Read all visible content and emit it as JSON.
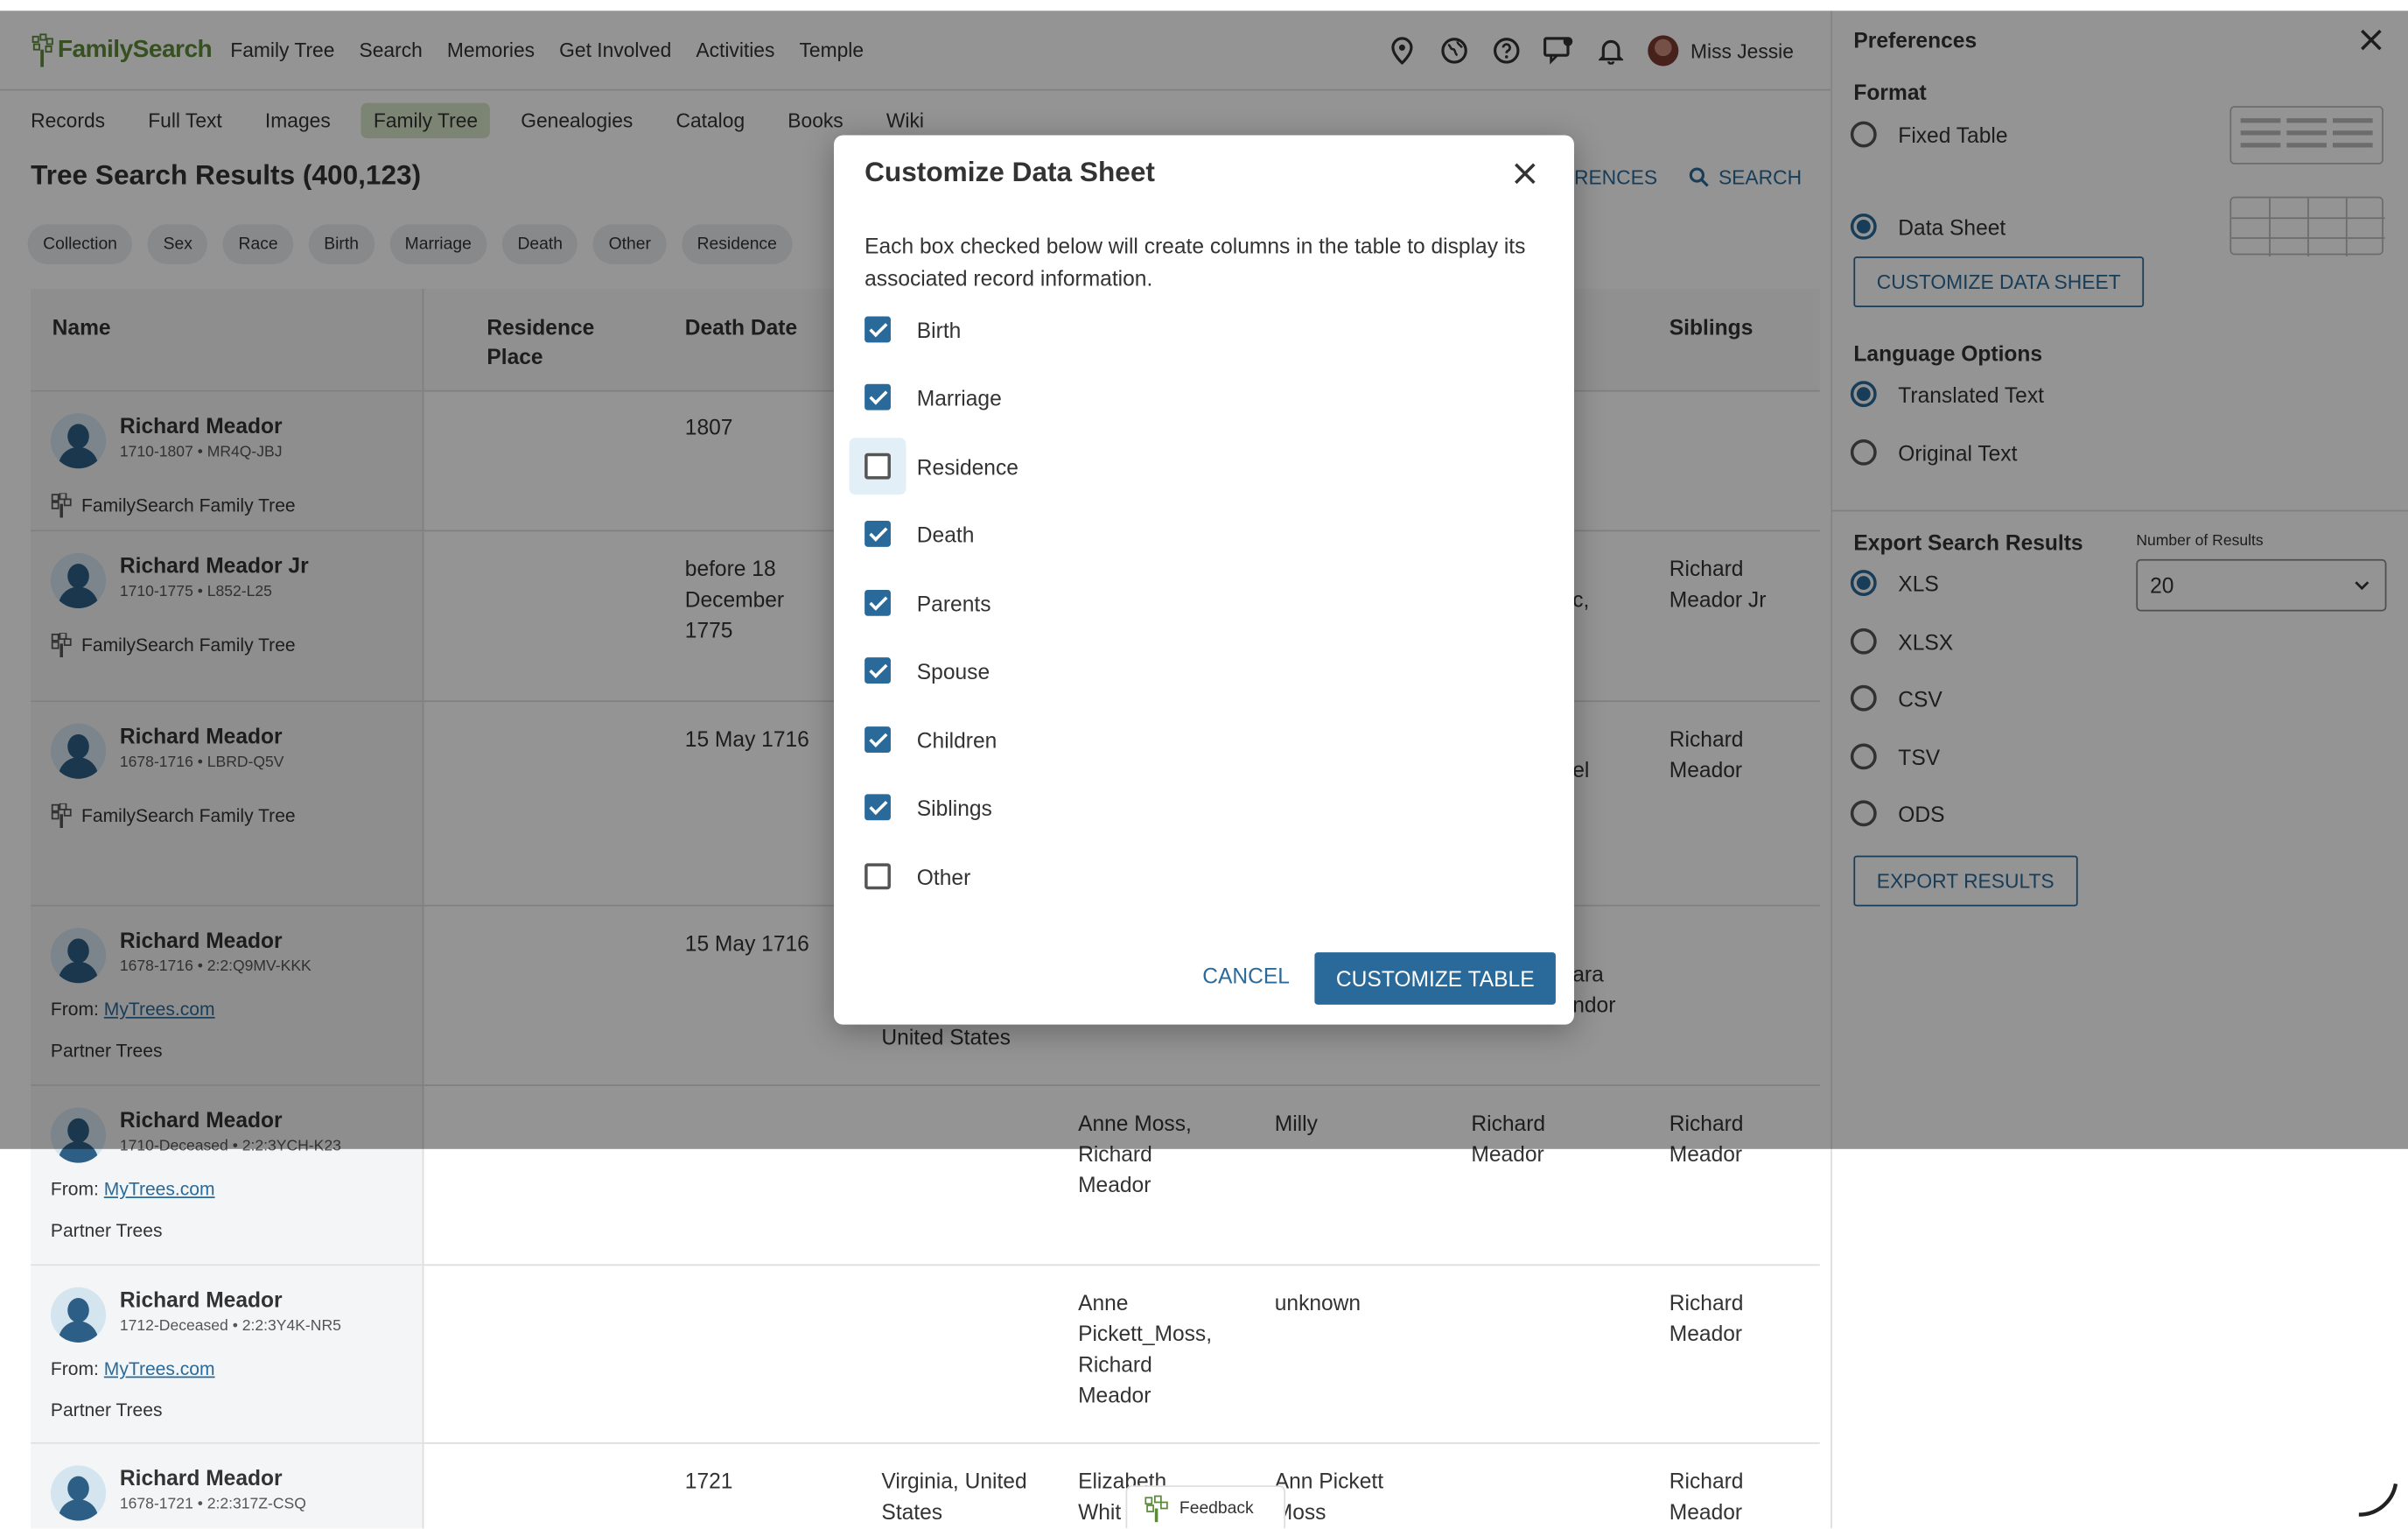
{
  "logo": {
    "text": "FamilySearch"
  },
  "topnav": {
    "items": [
      "Family Tree",
      "Search",
      "Memories",
      "Get Involved",
      "Activities",
      "Temple"
    ],
    "user_name": "Miss Jessie"
  },
  "subnav": {
    "items": [
      "Records",
      "Full Text",
      "Images",
      "Family Tree",
      "Genealogies",
      "Catalog",
      "Books",
      "Wiki"
    ],
    "active": "Family Tree"
  },
  "results": {
    "title": "Tree Search Results (400,123)",
    "preferences_link_partial": "RENCES",
    "search_link": "SEARCH"
  },
  "filters": [
    "Collection",
    "Sex",
    "Race",
    "Birth",
    "Marriage",
    "Death",
    "Other",
    "Residence"
  ],
  "table": {
    "headers": {
      "name": "Name",
      "residence_place": "Residence\nPlace",
      "death_date": "Death Date",
      "siblings": "Siblings"
    },
    "rows": [
      {
        "name": "Richard Meador",
        "meta": "1710-1807 • MR4Q-JBJ",
        "source": "FamilySearch Family Tree",
        "death_date": "1807",
        "siblings": ""
      },
      {
        "name": "Richard Meador Jr",
        "meta": "1710-1775 • L852-L25",
        "source": "FamilySearch Family Tree",
        "death_date": "before 18\nDecember\n1775",
        "col_c_partial": "c,",
        "siblings": "Richard\nMeador Jr"
      },
      {
        "name": "Richard Meador",
        "meta": "1678-1716 • LBRD-Q5V",
        "source": "FamilySearch Family Tree",
        "death_date": "15 May 1716",
        "col_c_partial": "el",
        "siblings": "Richard\nMeador"
      },
      {
        "name": "Richard Meador",
        "meta": "1678-1716 • 2:2:Q9MV-KKK",
        "from_label": "From:",
        "from_link": "MyTrees.com",
        "partner": "Partner Trees",
        "death_date": "15 May 1716",
        "death_place_partial": "United States",
        "col_c_partial": "ara\nndor",
        "siblings": ""
      },
      {
        "name": "Richard Meador",
        "meta": "1710-Deceased • 2:2:3YCH-K23",
        "from_label": "From:",
        "from_link": "MyTrees.com",
        "partner": "Partner Trees",
        "parents": "Anne Moss,\nRichard\nMeador",
        "spouse": "Milly",
        "children": "Richard\nMeador",
        "siblings": "Richard\nMeador"
      },
      {
        "name": "Richard Meador",
        "meta": "1712-Deceased • 2:2:3Y4K-NR5",
        "from_label": "From:",
        "from_link": "MyTrees.com",
        "partner": "Partner Trees",
        "parents": "Anne\nPickett_Moss,\nRichard\nMeador",
        "spouse": "unknown",
        "siblings": "Richard\nMeador"
      },
      {
        "name": "Richard Meador",
        "meta": "1678-1721 • 2:2:317Z-CSQ",
        "death_date": "1721",
        "death_place": "Virginia, United\nStates",
        "parents_partial": "Elizabeth\nWhit",
        "spouse": "Ann Pickett\nMoss",
        "siblings": "Richard\nMeador"
      }
    ]
  },
  "modal": {
    "title": "Customize Data Sheet",
    "description": "Each box checked below will create columns in the table to display its associated record information.",
    "options": [
      {
        "label": "Birth",
        "checked": true
      },
      {
        "label": "Marriage",
        "checked": true
      },
      {
        "label": "Residence",
        "checked": false
      },
      {
        "label": "Death",
        "checked": true
      },
      {
        "label": "Parents",
        "checked": true
      },
      {
        "label": "Spouse",
        "checked": true
      },
      {
        "label": "Children",
        "checked": true
      },
      {
        "label": "Siblings",
        "checked": true
      },
      {
        "label": "Other",
        "checked": false
      }
    ],
    "cancel_label": "CANCEL",
    "confirm_label": "CUSTOMIZE TABLE"
  },
  "preferences": {
    "title": "Preferences",
    "format_label": "Format",
    "format_options": [
      {
        "label": "Fixed Table",
        "selected": false
      },
      {
        "label": "Data Sheet",
        "selected": true
      }
    ],
    "customize_button": "CUSTOMIZE DATA SHEET",
    "language_label": "Language Options",
    "language_options": [
      {
        "label": "Translated Text",
        "selected": true
      },
      {
        "label": "Original Text",
        "selected": false
      }
    ],
    "export_label": "Export Search Results",
    "number_label": "Number of Results",
    "number_value": "20",
    "export_options": [
      {
        "label": "XLS",
        "selected": true
      },
      {
        "label": "XLSX",
        "selected": false
      },
      {
        "label": "CSV",
        "selected": false
      },
      {
        "label": "TSV",
        "selected": false
      },
      {
        "label": "ODS",
        "selected": false
      }
    ],
    "export_button": "EXPORT RESULTS"
  },
  "feedback": {
    "label": "Feedback"
  },
  "colors": {
    "accent": "#2a6a9a",
    "brand_green": "#5d8a3a"
  }
}
